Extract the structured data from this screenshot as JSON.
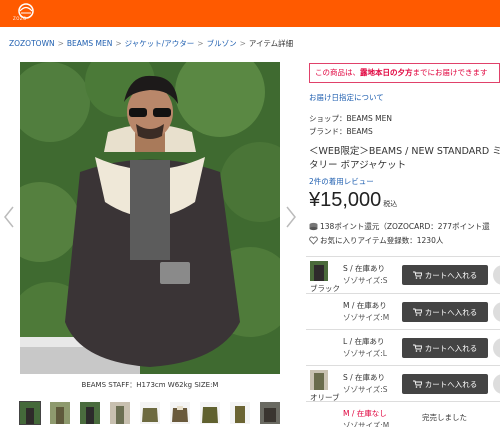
{
  "colors": {
    "header": "#ff5a00",
    "link": "#1f5fb0",
    "alert": "#e0003c",
    "button": "#444444"
  },
  "header": {
    "logo_word": "ZOZO"
  },
  "breadcrumb": [
    {
      "label": "ZOZOTOWN"
    },
    {
      "label": "BEAMS MEN"
    },
    {
      "label": "ジャケット/アウター"
    },
    {
      "label": "ブルゾン"
    },
    {
      "label": "アイテム詳細"
    }
  ],
  "breadcrumb_separator": ">",
  "photo": {
    "caption": "BEAMS STAFF：H173cm W62kg SIZE:M"
  },
  "notice": {
    "pre": "この商品は、",
    "bold": "露地本日の夕方",
    "post": "までにお届けできます"
  },
  "delivery_link": "お届け日指定について",
  "shop": "ショップ：BEAMS MEN",
  "brand": "ブランド：BEAMS",
  "product_name_line1": "＜WEB限定＞BEAMS / NEW STANDARD ミ",
  "product_name_line2": "タリー ボアジャケット",
  "review_link": "2件の着用レビュー",
  "price": "¥15,000",
  "tax_label": "税込",
  "points": "138ポイント還元（ZOZOCARD：277ポイント還",
  "favorites": "お気に入りアイテム登録数：1230人",
  "stock": [
    {
      "color": "ブラック",
      "size_stock": "S / 在庫あり",
      "variant": "ゾゾサイズ:S",
      "action": "カートへ入れる",
      "sold_out": false
    },
    {
      "color": "",
      "size_stock": "M / 在庫あり",
      "variant": "ゾゾサイズ:M",
      "action": "カートへ入れる",
      "sold_out": false
    },
    {
      "color": "",
      "size_stock": "L / 在庫あり",
      "variant": "ゾゾサイズ:L",
      "action": "カートへ入れる",
      "sold_out": false
    },
    {
      "color": "オリーブ",
      "size_stock": "S / 在庫あり",
      "variant": "ゾゾサイズ:S",
      "action": "カートへ入れる",
      "sold_out": false
    },
    {
      "color": "",
      "size_stock": "M / 在庫なし",
      "variant": "ゾゾサイズ:M",
      "action": "完売しました",
      "sold_out": true
    }
  ]
}
